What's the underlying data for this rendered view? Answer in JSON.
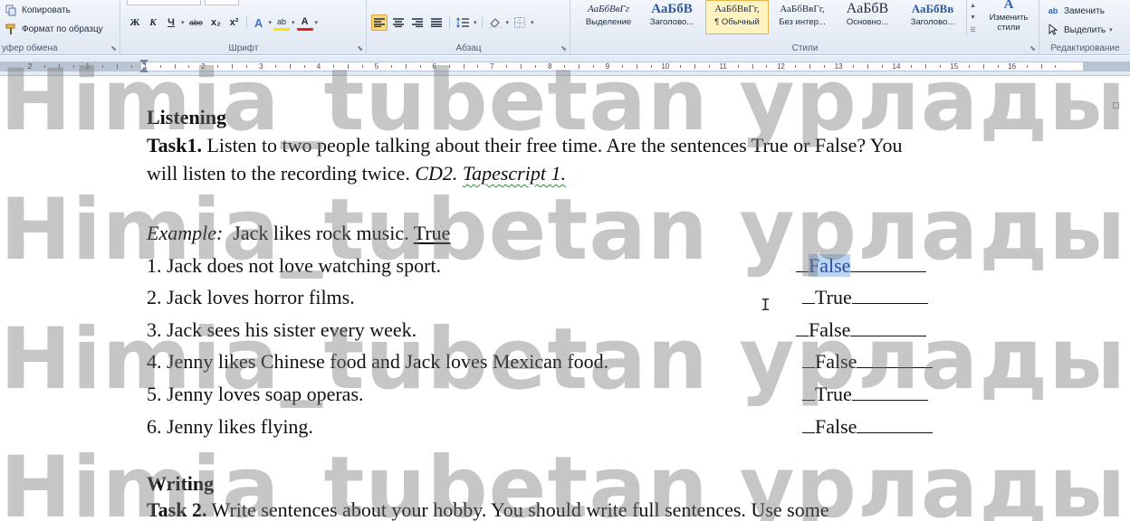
{
  "ribbon": {
    "clipboard": {
      "copy_label": "Копировать",
      "format_painter_label": "Формат по образцу",
      "group_label": "уфер обмена"
    },
    "font": {
      "group_label": "Шрифт",
      "buttons": [
        "Ж",
        "К",
        "Ч",
        "abe",
        "x₂",
        "x²",
        "A",
        "ab",
        "A"
      ]
    },
    "paragraph": {
      "group_label": "Абзац"
    },
    "styles": {
      "group_label": "Стили",
      "tiles": [
        {
          "sample": "АаБбВвГг",
          "name": "Выделение",
          "big": false,
          "selected": false
        },
        {
          "sample": "АаБбВ",
          "name": "Заголово...",
          "big": true,
          "selected": false
        },
        {
          "sample": "АаБбВвГг,",
          "name": "¶ Обычный",
          "big": false,
          "selected": true
        },
        {
          "sample": "АаБбВвГг,",
          "name": "Без интер...",
          "big": false,
          "selected": false
        },
        {
          "sample": "АаБбВ",
          "name": "Основно...",
          "big": true,
          "selected": false
        },
        {
          "sample": "АаБбВв",
          "name": "Заголово...",
          "big": true,
          "selected": false
        }
      ],
      "change_styles_label": "Изменить стили"
    },
    "editing": {
      "group_label": "Редактирование",
      "replace_label": "Заменить",
      "select_label": "Выделить"
    }
  },
  "ruler": {
    "numbers": [
      "2",
      "1",
      "1",
      "2",
      "3",
      "4",
      "5",
      "6",
      "7",
      "8",
      "9",
      "10",
      "11",
      "12",
      "13",
      "14",
      "15",
      "16"
    ]
  },
  "document": {
    "section1_heading": "Listening",
    "task1": {
      "label": "Task1.",
      "text": " Listen to two people talking about their free time. Are the sentences True or False? You",
      "line2_text": "will listen to the recording twice. ",
      "cd": "CD2.",
      "tapescript": "Tapescript 1."
    },
    "example": {
      "label": "Example:",
      "text": "  Jack likes rock music. ",
      "answer": "True"
    },
    "items": [
      {
        "text": "1. Jack does not love watching sport.",
        "answer": "False"
      },
      {
        "text": "2. Jack loves horror films.",
        "answer": "True"
      },
      {
        "text": "3. Jack sees his sister every week.",
        "answer": "False"
      },
      {
        "text": "4. Jenny likes Chinese food and Jack loves Mexican food.",
        "answer": "False"
      },
      {
        "text": "5. Jenny loves soap operas.",
        "answer": "True"
      },
      {
        "text": "6. Jenny likes flying.",
        "answer": "False"
      }
    ],
    "section2_heading": "Writing",
    "task2": {
      "label": "Task 2.",
      "text": " Write sentences about your hobby. You should write full sentences. Use some"
    }
  },
  "watermark": {
    "text": "Himia_tubetan урладым"
  },
  "colors": {
    "selection_highlight": "#b9d5f3",
    "spellcheck_squiggle": "#2e8b3a",
    "ribbon_selected_style": "#fff3c2"
  }
}
